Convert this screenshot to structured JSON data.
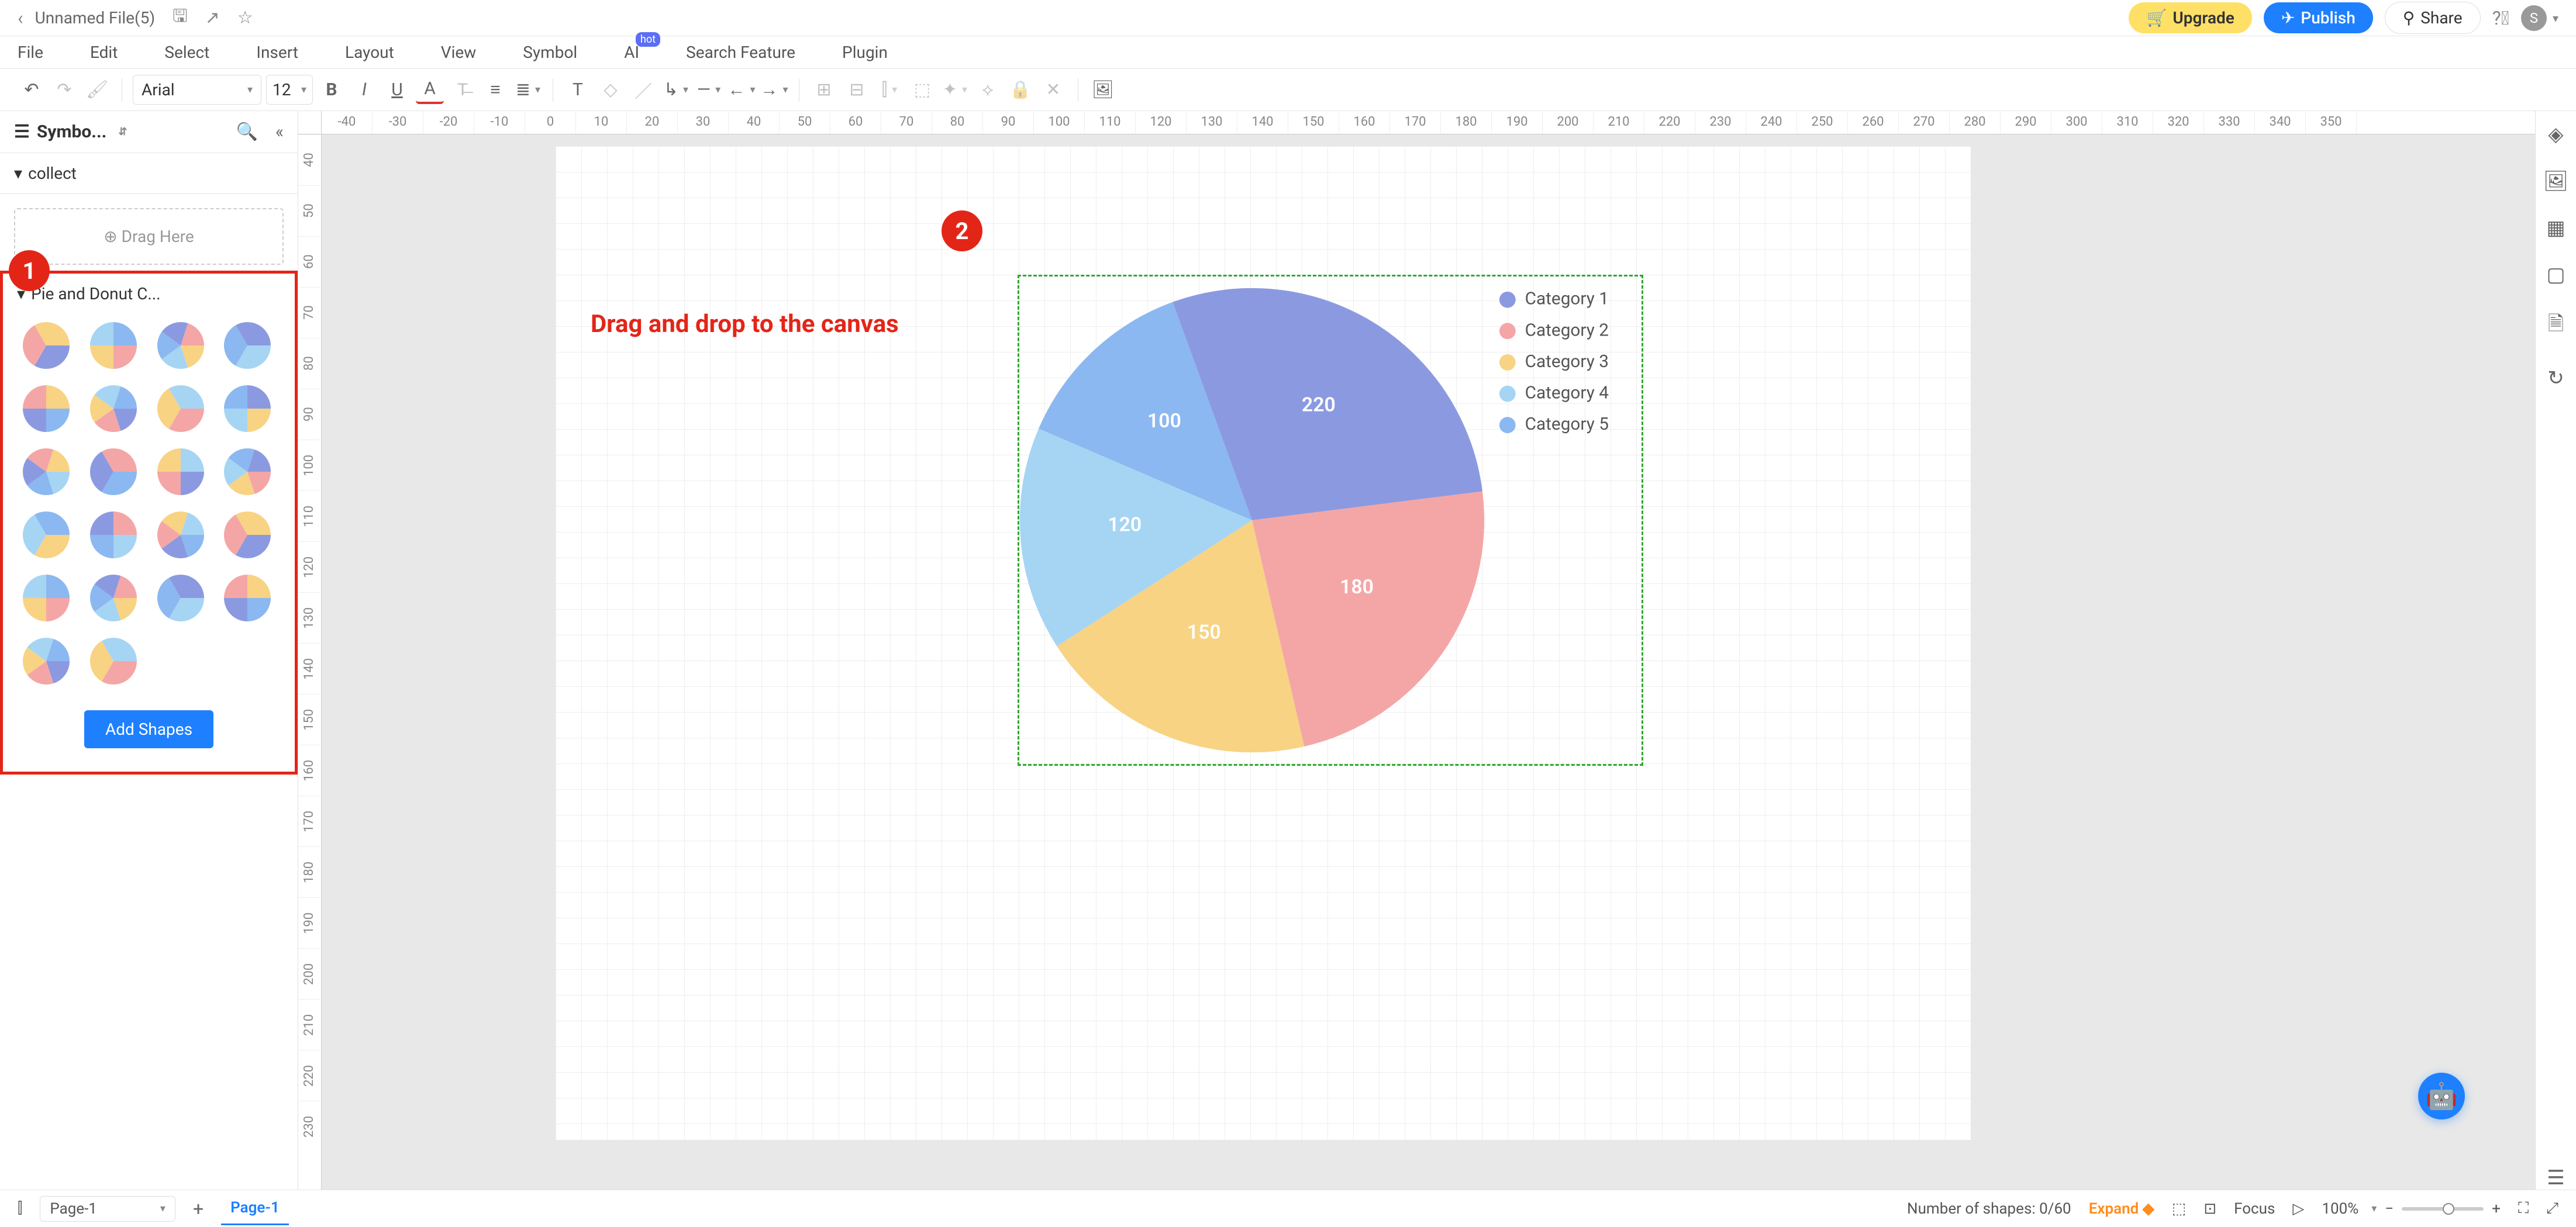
{
  "titlebar": {
    "filename": "Unnamed File(5)",
    "upgrade": "Upgrade",
    "publish": "Publish",
    "share": "Share",
    "avatar_letter": "S"
  },
  "menubar": {
    "items": [
      "File",
      "Edit",
      "Select",
      "Insert",
      "Layout",
      "View",
      "Symbol",
      "AI",
      "Search Feature",
      "Plugin"
    ],
    "hot_label": "hot"
  },
  "toolbar": {
    "font": "Arial",
    "font_size": "12"
  },
  "left_panel": {
    "title": "Symbo...",
    "collect_label": "collect",
    "drag_here": "Drag Here",
    "pie_section": "Pie and Donut C...",
    "add_shapes": "Add Shapes"
  },
  "ruler_h": [
    "-40",
    "-30",
    "-20",
    "-10",
    "0",
    "10",
    "20",
    "30",
    "40",
    "50",
    "60",
    "70",
    "80",
    "90",
    "100",
    "110",
    "120",
    "130",
    "140",
    "150",
    "160",
    "170",
    "180",
    "190",
    "200",
    "210",
    "220",
    "230",
    "240",
    "250",
    "260",
    "270",
    "280",
    "290",
    "300",
    "310",
    "320",
    "330",
    "340",
    "350"
  ],
  "ruler_v": [
    "40",
    "50",
    "60",
    "70",
    "80",
    "90",
    "100",
    "110",
    "120",
    "130",
    "140",
    "150",
    "160",
    "170",
    "180",
    "190",
    "200",
    "210",
    "220",
    "230"
  ],
  "annotations": {
    "step1": "1",
    "step2": "2",
    "drop_label": "Drag and drop to the canvas"
  },
  "chart_data": {
    "type": "pie",
    "title": "",
    "series": [
      {
        "name": "Category 1",
        "value": 220,
        "color": "#8b9ae0"
      },
      {
        "name": "Category 2",
        "value": 180,
        "color": "#f4a6a6"
      },
      {
        "name": "Category 3",
        "value": 150,
        "color": "#f8d383"
      },
      {
        "name": "Category 4",
        "value": 120,
        "color": "#a6d5f4"
      },
      {
        "name": "Category 5",
        "value": 100,
        "color": "#8bb8f0"
      }
    ]
  },
  "right_rail_icons": [
    "fill-icon",
    "image-icon",
    "grid-icon",
    "present-icon",
    "doc-icon",
    "history-icon"
  ],
  "statusbar": {
    "page_select": "Page-1",
    "active_page": "Page-1",
    "shape_count": "Number of shapes: 0/60",
    "expand": "Expand",
    "focus": "Focus",
    "zoom": "100%"
  }
}
